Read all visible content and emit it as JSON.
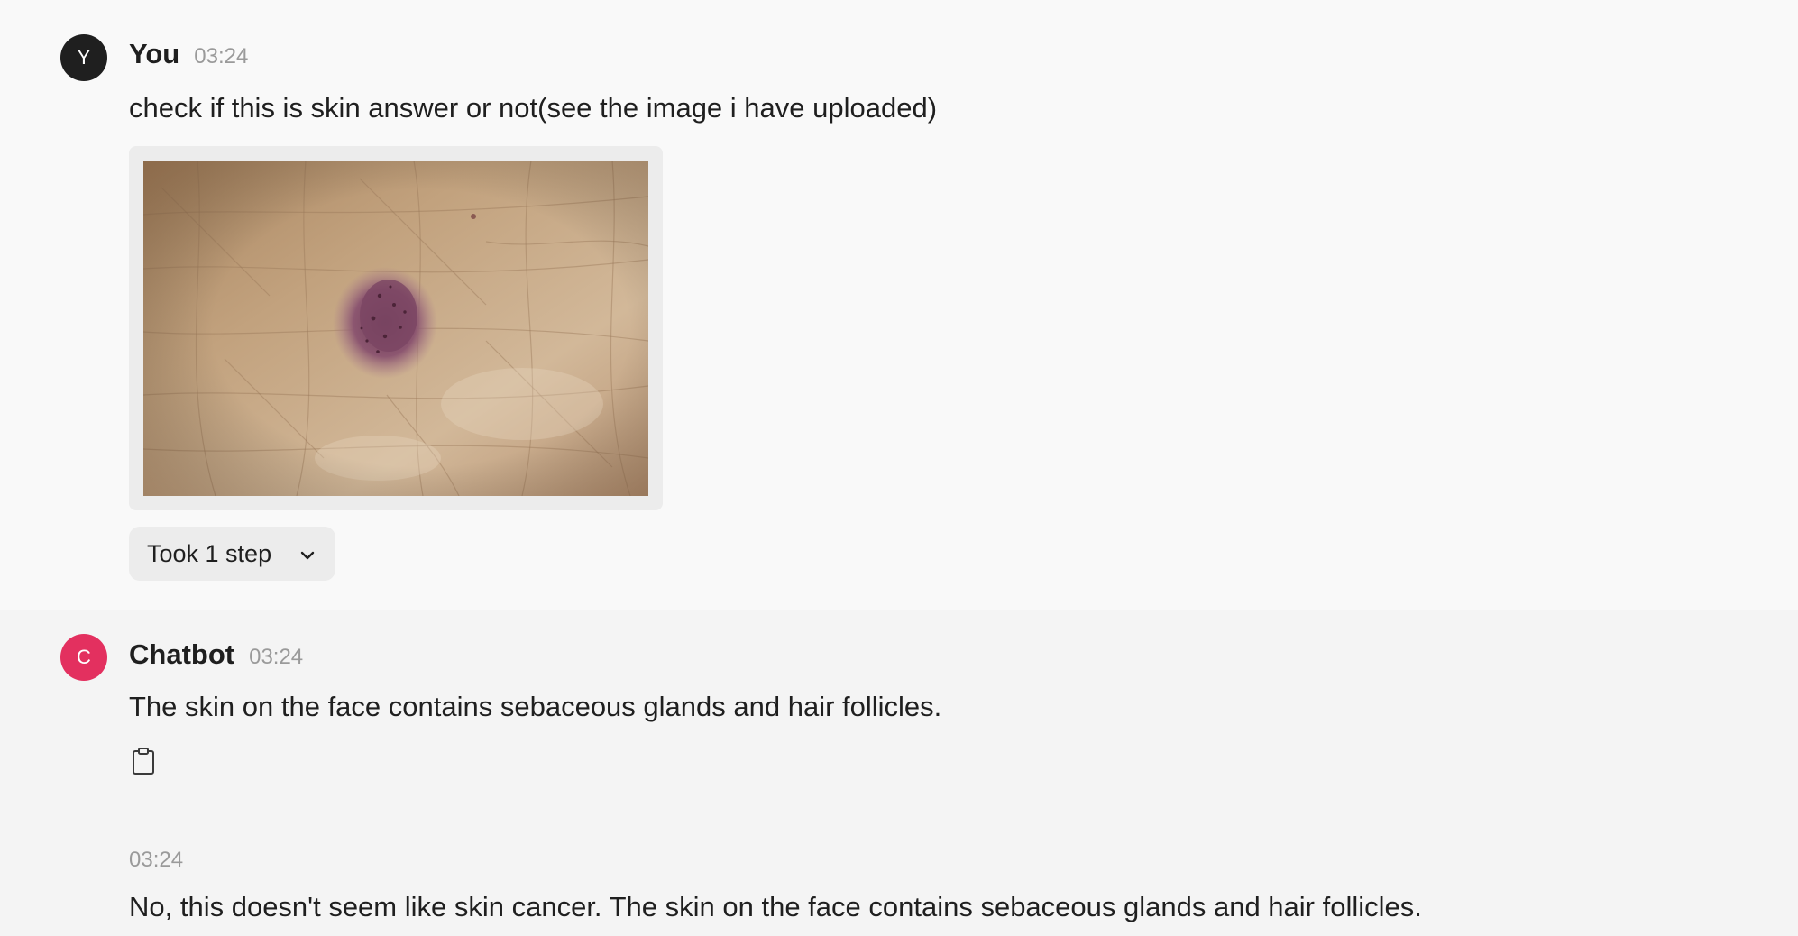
{
  "user_message": {
    "avatar_letter": "Y",
    "author": "You",
    "time": "03:24",
    "text": "check if this is skin answer or not(see the image i have uploaded)",
    "steps_label": "Took 1 step",
    "steps_icon": "chevron-down-icon"
  },
  "bot_message": {
    "avatar_letter": "C",
    "author": "Chatbot",
    "time": "03:24",
    "text": "The skin on the face contains sebaceous glands and hair follicles.",
    "copy_icon": "clipboard-icon",
    "followup_time": "03:24",
    "followup_text": "No, this doesn't seem like skin cancer. The skin on the face contains sebaceous glands and hair follicles."
  },
  "colors": {
    "user_avatar": "#1f1f1f",
    "bot_avatar": "#e3305f",
    "user_bg": "#f9f9f9",
    "bot_bg": "#f4f4f4"
  }
}
